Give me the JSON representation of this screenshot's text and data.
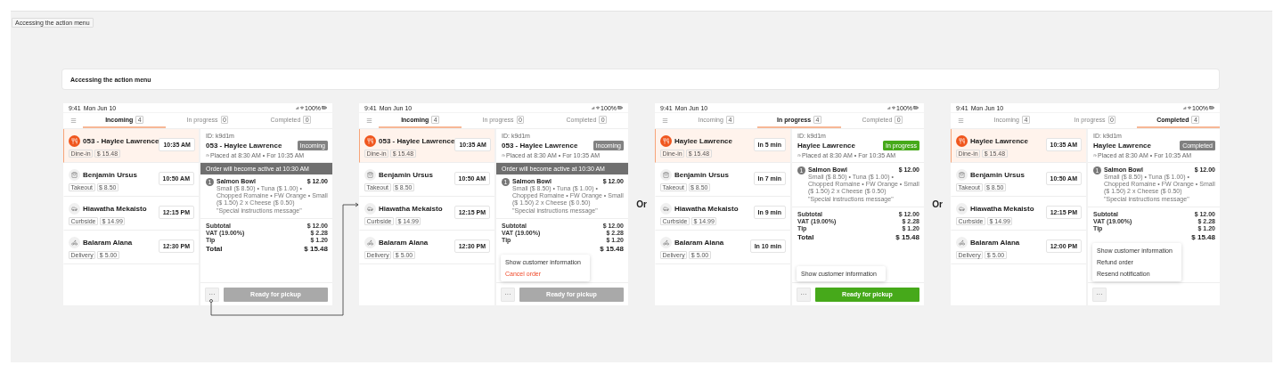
{
  "frame_label": "Accessing the action menu",
  "header": {
    "title": "Accessing the action menu"
  },
  "transitions": [
    {
      "kind": "arrow"
    },
    {
      "kind": "text",
      "label": "Or"
    },
    {
      "kind": "text",
      "label": "Or"
    }
  ],
  "screens": [
    {
      "status": {
        "time": "9:41",
        "date": "Mon Jun 10",
        "battery": "100%"
      },
      "tabs": [
        {
          "label": "Incoming",
          "count": "4",
          "selected": true
        },
        {
          "label": "In progress",
          "count": "0",
          "selected": false
        },
        {
          "label": "Completed",
          "count": "0",
          "selected": false
        }
      ],
      "orders": [
        {
          "name": "053 - Haylee Lawrence",
          "kind": "dine_in",
          "tag": "Dine-in",
          "amount": "$ 15.48",
          "time": "10:35 AM",
          "selected": true
        },
        {
          "name": "Benjamin Ursus",
          "kind": "takeout",
          "tag": "Takeout",
          "amount": "$ 8.50",
          "time": "10:50 AM",
          "selected": false
        },
        {
          "name": "Hiawatha Mekaisto",
          "kind": "curbside",
          "tag": "Curbside",
          "amount": "$ 14.99",
          "time": "12:15 PM",
          "selected": false
        },
        {
          "name": "Balaram Alana",
          "kind": "delivery",
          "tag": "Delivery",
          "amount": "$ 5.00",
          "time": "12:30 PM",
          "selected": false
        }
      ],
      "detail": {
        "id": "ID: k9d1m",
        "title": "053 - Haylee Lawrence",
        "badge": {
          "label": "Incoming",
          "kind": "incoming"
        },
        "placed": "Placed at 8:30 AM • For 10:35 AM",
        "banner": "Order will become active at 10:30 AM",
        "item": {
          "qty": "1",
          "name": "Salmon Bowl",
          "price": "$ 12.00",
          "modifiers": "Small ($ 8.50) • Tuna ($ 1.00) • Chopped Romaine • FW Orange • Small ($ 1.50) 2 x Cheese ($ 0.50)",
          "note": "\"Special instructions message\""
        },
        "totals": [
          {
            "label": "Subtotal",
            "value": "$ 12.00"
          },
          {
            "label": "VAT (19.00%)",
            "value": "$ 2.28"
          },
          {
            "label": "Tip",
            "value": "$ 1.20"
          }
        ],
        "total": {
          "label": "Total",
          "value": "$ 15.48"
        },
        "more": "···",
        "primary": {
          "label": "Ready for pickup",
          "disabled": true
        }
      }
    },
    {
      "status": {
        "time": "9:41",
        "date": "Mon Jun 10",
        "battery": "100%"
      },
      "tabs": [
        {
          "label": "Incoming",
          "count": "4",
          "selected": true
        },
        {
          "label": "In progress",
          "count": "0",
          "selected": false
        },
        {
          "label": "Completed",
          "count": "0",
          "selected": false
        }
      ],
      "orders": [
        {
          "name": "053 - Haylee Lawrence",
          "kind": "dine_in",
          "tag": "Dine-in",
          "amount": "$ 15.48",
          "time": "10:35 AM",
          "selected": true
        },
        {
          "name": "Benjamin Ursus",
          "kind": "takeout",
          "tag": "Takeout",
          "amount": "$ 8.50",
          "time": "10:50 AM",
          "selected": false
        },
        {
          "name": "Hiawatha Mekaisto",
          "kind": "curbside",
          "tag": "Curbside",
          "amount": "$ 14.99",
          "time": "12:15 PM",
          "selected": false
        },
        {
          "name": "Balaram Alana",
          "kind": "delivery",
          "tag": "Delivery",
          "amount": "$ 5.00",
          "time": "12:30 PM",
          "selected": false
        }
      ],
      "detail": {
        "id": "ID: k9d1m",
        "title": "053 - Haylee Lawrence",
        "badge": {
          "label": "Incoming",
          "kind": "incoming"
        },
        "placed": "Placed at 8:30 AM • For 10:35 AM",
        "banner": "Order will become active at 10:30 AM",
        "item": {
          "qty": "1",
          "name": "Salmon Bowl",
          "price": "$ 12.00",
          "modifiers": "Small ($ 8.50) • Tuna ($ 1.00) • Chopped Romaine • FW Orange • Small ($ 1.50) 2 x Cheese ($ 0.50)",
          "note": "\"Special instructions message\""
        },
        "totals": [
          {
            "label": "Subtotal",
            "value": "$ 12.00"
          },
          {
            "label": "VAT (19.00%)",
            "value": "$ 2.28"
          },
          {
            "label": "Tip",
            "value": "$ 1.20"
          }
        ],
        "total": {
          "value": "$ 15.48"
        },
        "more": "···",
        "primary": {
          "label": "Ready for pickup",
          "disabled": true
        },
        "menu": [
          {
            "label": "Show customer information",
            "kind": "normal"
          },
          {
            "label": "Cancel order",
            "kind": "danger"
          }
        ]
      }
    },
    {
      "status": {
        "time": "9:41",
        "date": "Mon Jun 10",
        "battery": "100%"
      },
      "tabs": [
        {
          "label": "Incoming",
          "count": "4",
          "selected": false
        },
        {
          "label": "In progress",
          "count": "4",
          "selected": true
        },
        {
          "label": "Completed",
          "count": "0",
          "selected": false
        }
      ],
      "orders": [
        {
          "name": "Haylee Lawrence",
          "kind": "dine_in",
          "tag": "Dine-in",
          "amount": "$ 15.48",
          "time": "In 5 min",
          "selected": true
        },
        {
          "name": "Benjamin Ursus",
          "kind": "takeout",
          "tag": "Takeout",
          "amount": "$ 8.50",
          "time": "In 7 min",
          "selected": false
        },
        {
          "name": "Hiawatha Mekaisto",
          "kind": "curbside",
          "tag": "Curbside",
          "amount": "$ 14.99",
          "time": "In 9 min",
          "selected": false
        },
        {
          "name": "Balaram Alana",
          "kind": "delivery",
          "tag": "Delivery",
          "amount": "$ 5.00",
          "time": "In 10 min",
          "selected": false
        }
      ],
      "detail": {
        "id": "ID: k9d1m",
        "title": "Haylee Lawrence",
        "badge": {
          "label": "In progress",
          "kind": "in_progress"
        },
        "placed": "Placed at 8:30 AM • For 10:35 AM",
        "item": {
          "qty": "1",
          "name": "Salmon Bowl",
          "price": "$ 12.00",
          "modifiers": "Small ($ 8.50) • Tuna ($ 1.00) • Chopped Romaine • FW Orange • Small ($ 1.50) 2 x Cheese ($ 0.50)",
          "note": "\"Special instructions message\""
        },
        "totals": [
          {
            "label": "Subtotal",
            "value": "$ 12.00"
          },
          {
            "label": "VAT (19.00%)",
            "value": "$ 2.28"
          },
          {
            "label": "Tip",
            "value": "$ 1.20"
          }
        ],
        "total": {
          "label": "Total",
          "value": "$ 15.48"
        },
        "more": "···",
        "primary": {
          "label": "Ready for pickup",
          "disabled": false
        },
        "menu": [
          {
            "label": "Show customer information",
            "kind": "normal"
          }
        ]
      }
    },
    {
      "status": {
        "time": "9:41",
        "date": "Mon Jun 10",
        "battery": "100%"
      },
      "tabs": [
        {
          "label": "Incoming",
          "count": "4",
          "selected": false
        },
        {
          "label": "In progress",
          "count": "0",
          "selected": false
        },
        {
          "label": "Completed",
          "count": "4",
          "selected": true
        }
      ],
      "orders": [
        {
          "name": "Haylee Lawrence",
          "kind": "dine_in",
          "tag": "Dine-in",
          "amount": "$ 15.48",
          "time": "10:35 AM",
          "selected": true
        },
        {
          "name": "Benjamin Ursus",
          "kind": "takeout",
          "tag": "Takeout",
          "amount": "$ 8.50",
          "time": "10:50 AM",
          "selected": false
        },
        {
          "name": "Hiawatha Mekaisto",
          "kind": "curbside",
          "tag": "Curbside",
          "amount": "$ 14.99",
          "time": "12:15 PM",
          "selected": false
        },
        {
          "name": "Balaram Alana",
          "kind": "delivery",
          "tag": "Delivery",
          "amount": "$ 5.00",
          "time": "12:00 PM",
          "selected": false
        }
      ],
      "detail": {
        "id": "ID: k9d1m",
        "title": "Haylee Lawrence",
        "badge": {
          "label": "Completed",
          "kind": "completed"
        },
        "placed": "Placed at 8:30 AM • For 10:35 AM",
        "item": {
          "qty": "1",
          "name": "Salmon Bowl",
          "price": "$ 12.00",
          "modifiers": "Small ($ 8.50) • Tuna ($ 1.00) • Chopped Romaine • FW Orange • Small ($ 1.50) 2 x Cheese ($ 0.50)",
          "note": "\"Special instructions message\""
        },
        "totals": [
          {
            "label": "Subtotal",
            "value": "$ 12.00"
          },
          {
            "label": "VAT (19.00%)",
            "value": "$ 2.28"
          },
          {
            "label": "Tip",
            "value": "$ 1.20"
          }
        ],
        "total": {
          "value": "$ 15.48"
        },
        "more": "···",
        "menu": [
          {
            "label": "Show customer information",
            "kind": "normal"
          },
          {
            "label": "Refund order",
            "kind": "normal"
          },
          {
            "label": "Resend notification",
            "kind": "normal"
          }
        ]
      }
    }
  ]
}
